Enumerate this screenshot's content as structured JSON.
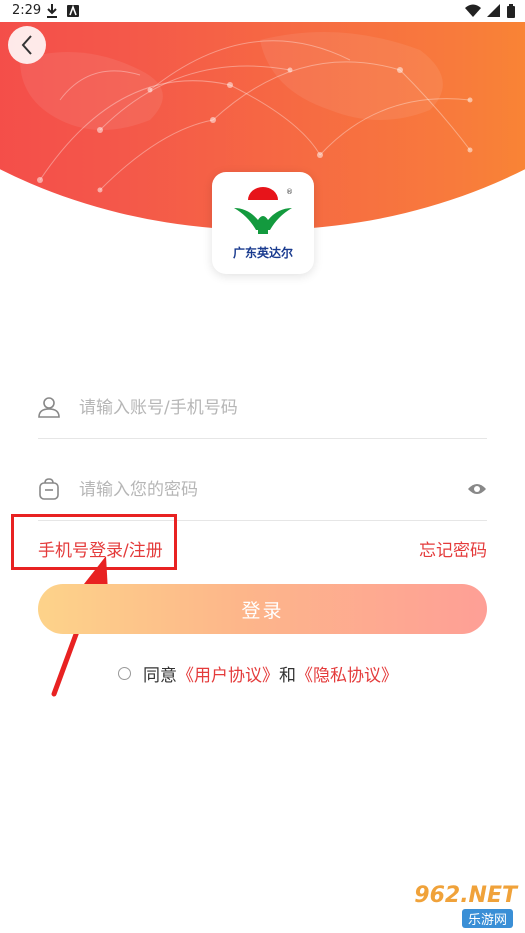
{
  "status_bar": {
    "time": "2:29"
  },
  "logo": {
    "brand_text": "广东英达尔"
  },
  "form": {
    "account_placeholder": "请输入账号/手机号码",
    "password_placeholder": "请输入您的密码",
    "phone_login_label": "手机号登录/注册",
    "forgot_password_label": "忘记密码",
    "login_button_label": "登录"
  },
  "agreement": {
    "prefix": "同意",
    "user_agreement": "《用户协议》",
    "and": "和",
    "privacy_policy": "《隐私协议》"
  },
  "watermark": {
    "top": "962.NET",
    "bottom": "乐游网"
  },
  "colors": {
    "accent_red": "#e43b3b",
    "gradient_start": "#f53d48",
    "gradient_end": "#fca21b"
  }
}
